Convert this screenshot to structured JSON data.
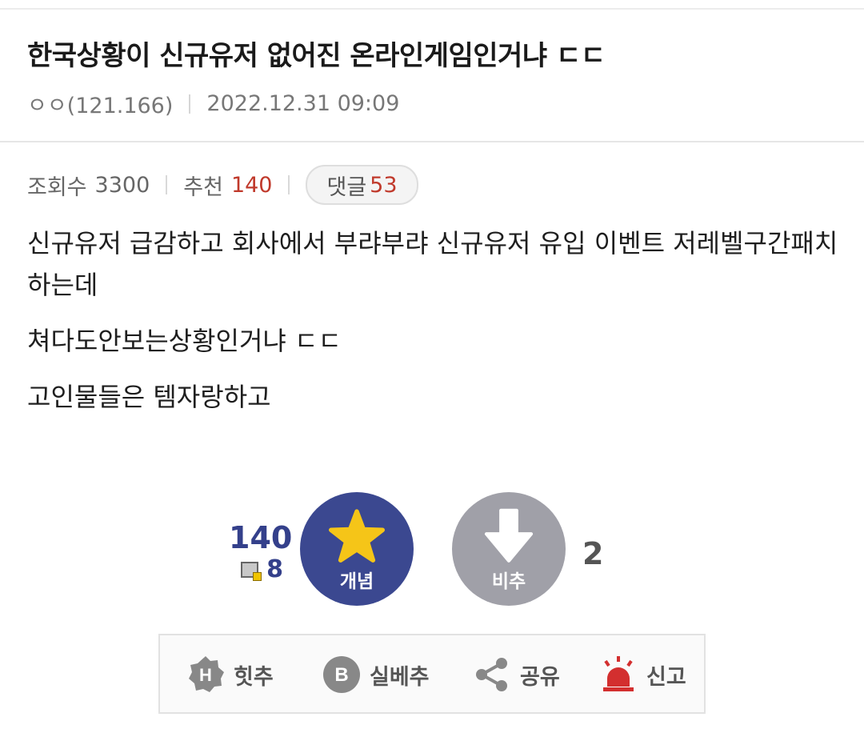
{
  "post": {
    "title": "한국상황이 신규유저 없어진 온라인게임인거냐 ㄷㄷ",
    "author": "ㅇㅇ(121.166)",
    "date": "2022.12.31 09:09"
  },
  "stats": {
    "views_label": "조회수",
    "views": "3300",
    "recommend_label": "추천",
    "recommend": "140",
    "comments_label": "댓글",
    "comments": "53"
  },
  "body": {
    "paragraphs": [
      "신규유저 급감하고 회사에서 부랴부랴 신규유저 유입 이벤트 저레벨구간패치 하는데",
      "쳐다도안보는상황인거냐 ㄷㄷ",
      "고인물들은 템자랑하고"
    ]
  },
  "vote": {
    "up_count": "140",
    "gallog_count": "8",
    "up_label": "개념",
    "down_label": "비추",
    "down_count": "2"
  },
  "actions": {
    "hit_label": "힛추",
    "best_label": "실베추",
    "share_label": "공유",
    "report_label": "신고"
  },
  "colors": {
    "accent_blue": "#3b4890",
    "recommend_red": "#c0392b",
    "star_yellow": "#f5c518",
    "report_red": "#d32f2f",
    "down_gray": "#a0a0a8"
  },
  "icons": {
    "up": "star-icon",
    "down": "arrow-down-icon",
    "hit": "hexagon-h-icon",
    "best": "circle-b-icon",
    "share": "share-icon",
    "report": "siren-icon"
  }
}
